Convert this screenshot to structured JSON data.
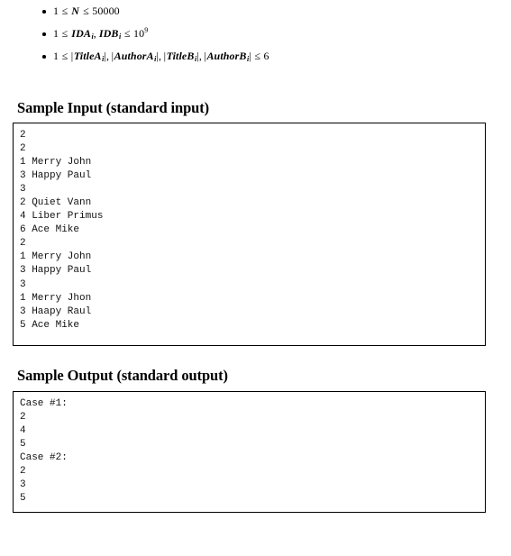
{
  "constraints": {
    "items": [
      {
        "id": "constraint-n",
        "text": "1 ≤ N ≤ 50000",
        "parts": {
          "lower": "1",
          "rel1": "≤",
          "var": "N",
          "rel2": "≤",
          "upper": "50000"
        }
      },
      {
        "id": "constraint-id",
        "text": "1 ≤ IDA_i, IDB_i ≤ 10^9",
        "parts": {
          "lower": "1",
          "rel1": "≤",
          "var1": "IDA",
          "var1_sub": "i",
          "comma": ",",
          "var2": "IDB",
          "var2_sub": "i",
          "rel2": "≤",
          "base": "10",
          "exponent": "9"
        }
      },
      {
        "id": "constraint-lengths",
        "text": "1 ≤ |TitleA_i|, |AuthorA_i|, |TitleB_i|, |AuthorB_i| ≤ 6",
        "parts": {
          "lower": "1",
          "rel1": "≤",
          "bar": "|",
          "comma": ",",
          "var1": "TitleA",
          "var1_sub": "i",
          "var2": "AuthorA",
          "var2_sub": "i",
          "var3": "TitleB",
          "var3_sub": "i",
          "var4": "AuthorB",
          "var4_sub": "i",
          "rel2": "≤",
          "upper": "6"
        }
      }
    ]
  },
  "sample_input": {
    "heading": "Sample Input (standard input)",
    "content": "2\n2\n1 Merry John\n3 Happy Paul\n3\n2 Quiet Vann\n4 Liber Primus\n6 Ace Mike\n2\n1 Merry John\n3 Happy Paul\n3\n1 Merry Jhon\n3 Haapy Raul\n5 Ace Mike"
  },
  "sample_output": {
    "heading": "Sample Output (standard output)",
    "content": "Case #1:\n2\n4\n5\nCase #2:\n2\n3\n5"
  },
  "colors": {
    "text": "#000000",
    "code_text": "#111111",
    "border": "#000000",
    "background": "#ffffff"
  }
}
